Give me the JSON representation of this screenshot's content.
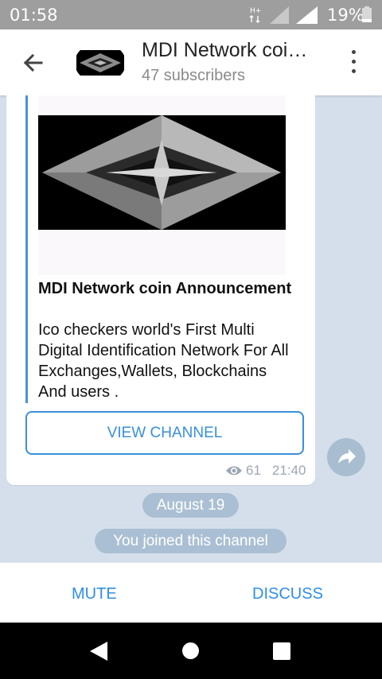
{
  "status_bar": {
    "time": "01:58",
    "network_label": "H+",
    "battery_percent": "19%"
  },
  "header": {
    "title": "MDI Network coi…",
    "subtitle": "47 subscribers"
  },
  "message": {
    "link_title": "MDI Network coin Announcement",
    "link_description": "Ico checkers world's First Multi Digital Identification Network For All Exchanges,Wallets, Blockchains And users .",
    "view_button_label": "VIEW CHANNEL",
    "views": "61",
    "time": "21:40"
  },
  "service": {
    "date": "August 19",
    "joined": "You joined this channel"
  },
  "bottom_bar": {
    "mute_label": "MUTE",
    "discuss_label": "DISCUSS"
  },
  "colors": {
    "accent": "#3a8fd9",
    "chat_background": "#d5dfec",
    "pill_background": "#aabfd3",
    "status_bar": "#9e9e9e"
  },
  "icons": {
    "back": "arrow-left-icon",
    "menu": "more-vertical-icon",
    "views": "eye-icon",
    "share": "share-arrow-icon",
    "nav_back": "triangle-back-icon",
    "nav_home": "circle-home-icon",
    "nav_recent": "square-recent-icon"
  }
}
